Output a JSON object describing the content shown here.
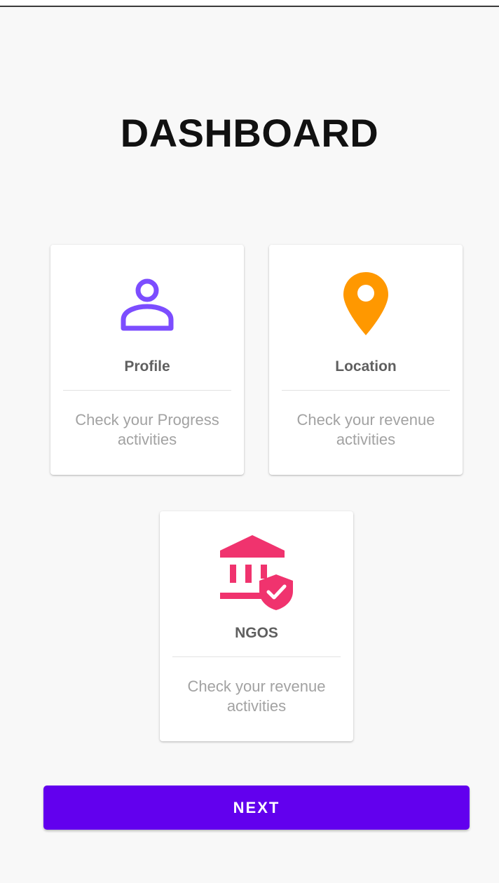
{
  "header": {
    "title": "DASHBOARD"
  },
  "cards": [
    {
      "label": "Profile",
      "description": "Check your Progress activities",
      "icon": "person-icon",
      "color": "#7c4dff"
    },
    {
      "label": "Location",
      "description": "Check your revenue activities",
      "icon": "location-pin-icon",
      "color": "#ff9800"
    },
    {
      "label": "NGOS",
      "description": "Check your revenue activities",
      "icon": "bank-shield-icon",
      "color": "#f0336e"
    }
  ],
  "actions": {
    "next_label": "NEXT",
    "next_color": "#6200ee"
  }
}
